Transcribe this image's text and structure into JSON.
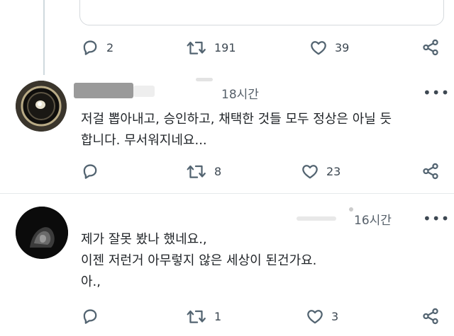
{
  "top_post": {
    "replies": "2",
    "retweets": "191",
    "likes": "39"
  },
  "replies": [
    {
      "time": "18시간",
      "text_lines": [
        "저걸 뽑아내고, 승인하고, 채택한 것들 모두 정상은 아닐 듯",
        "합니다. 무서워지네요..."
      ],
      "replies": "",
      "retweets": "8",
      "likes": "23"
    },
    {
      "time": "16시간",
      "text_lines": [
        "제가 잘못 봤나 했네요.,",
        "이젠 저런거 아무렇지 않은 세상이 된건가요.",
        "아.,"
      ],
      "replies": "",
      "retweets": "1",
      "likes": "3"
    }
  ],
  "more_label": "•••",
  "icons": {
    "reply": "reply-bubble-icon",
    "retweet": "retweet-icon",
    "like": "heart-icon",
    "share": "share-icon",
    "more": "more-options-icon"
  },
  "colors": {
    "icon": "#536471",
    "divider": "#e6e9eb",
    "thread_line": "#cfd9de"
  }
}
